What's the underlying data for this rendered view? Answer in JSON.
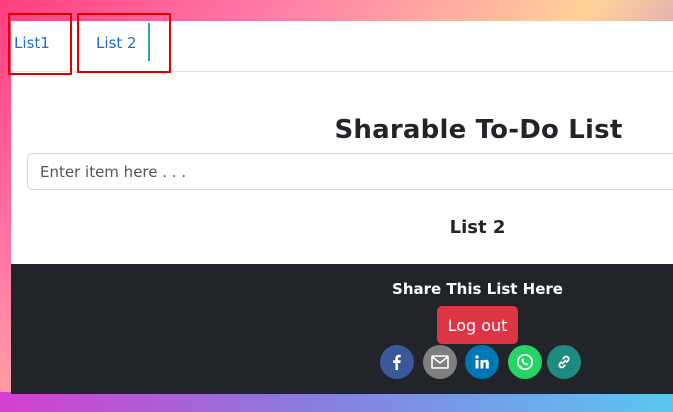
{
  "tabs": [
    {
      "label": "List1"
    },
    {
      "label": "List 2"
    }
  ],
  "main": {
    "title": "Sharable To-Do List",
    "input_placeholder": "Enter item here . . .",
    "list_heading": "List 2"
  },
  "footer": {
    "share_text": "Share This List Here",
    "logout_label": "Log out",
    "social_icons": [
      "facebook-icon",
      "email-icon",
      "linkedin-icon",
      "whatsapp-icon",
      "link-icon"
    ]
  },
  "colors": {
    "tab_link": "#1a6fd0",
    "highlight": "#e00000",
    "footer_bg": "#212529",
    "logout_bg": "#dc3545",
    "facebook": "#3b5998",
    "email": "#7f7f7f",
    "linkedin": "#0077b5",
    "whatsapp": "#25d366",
    "link": "#1f8a80"
  }
}
